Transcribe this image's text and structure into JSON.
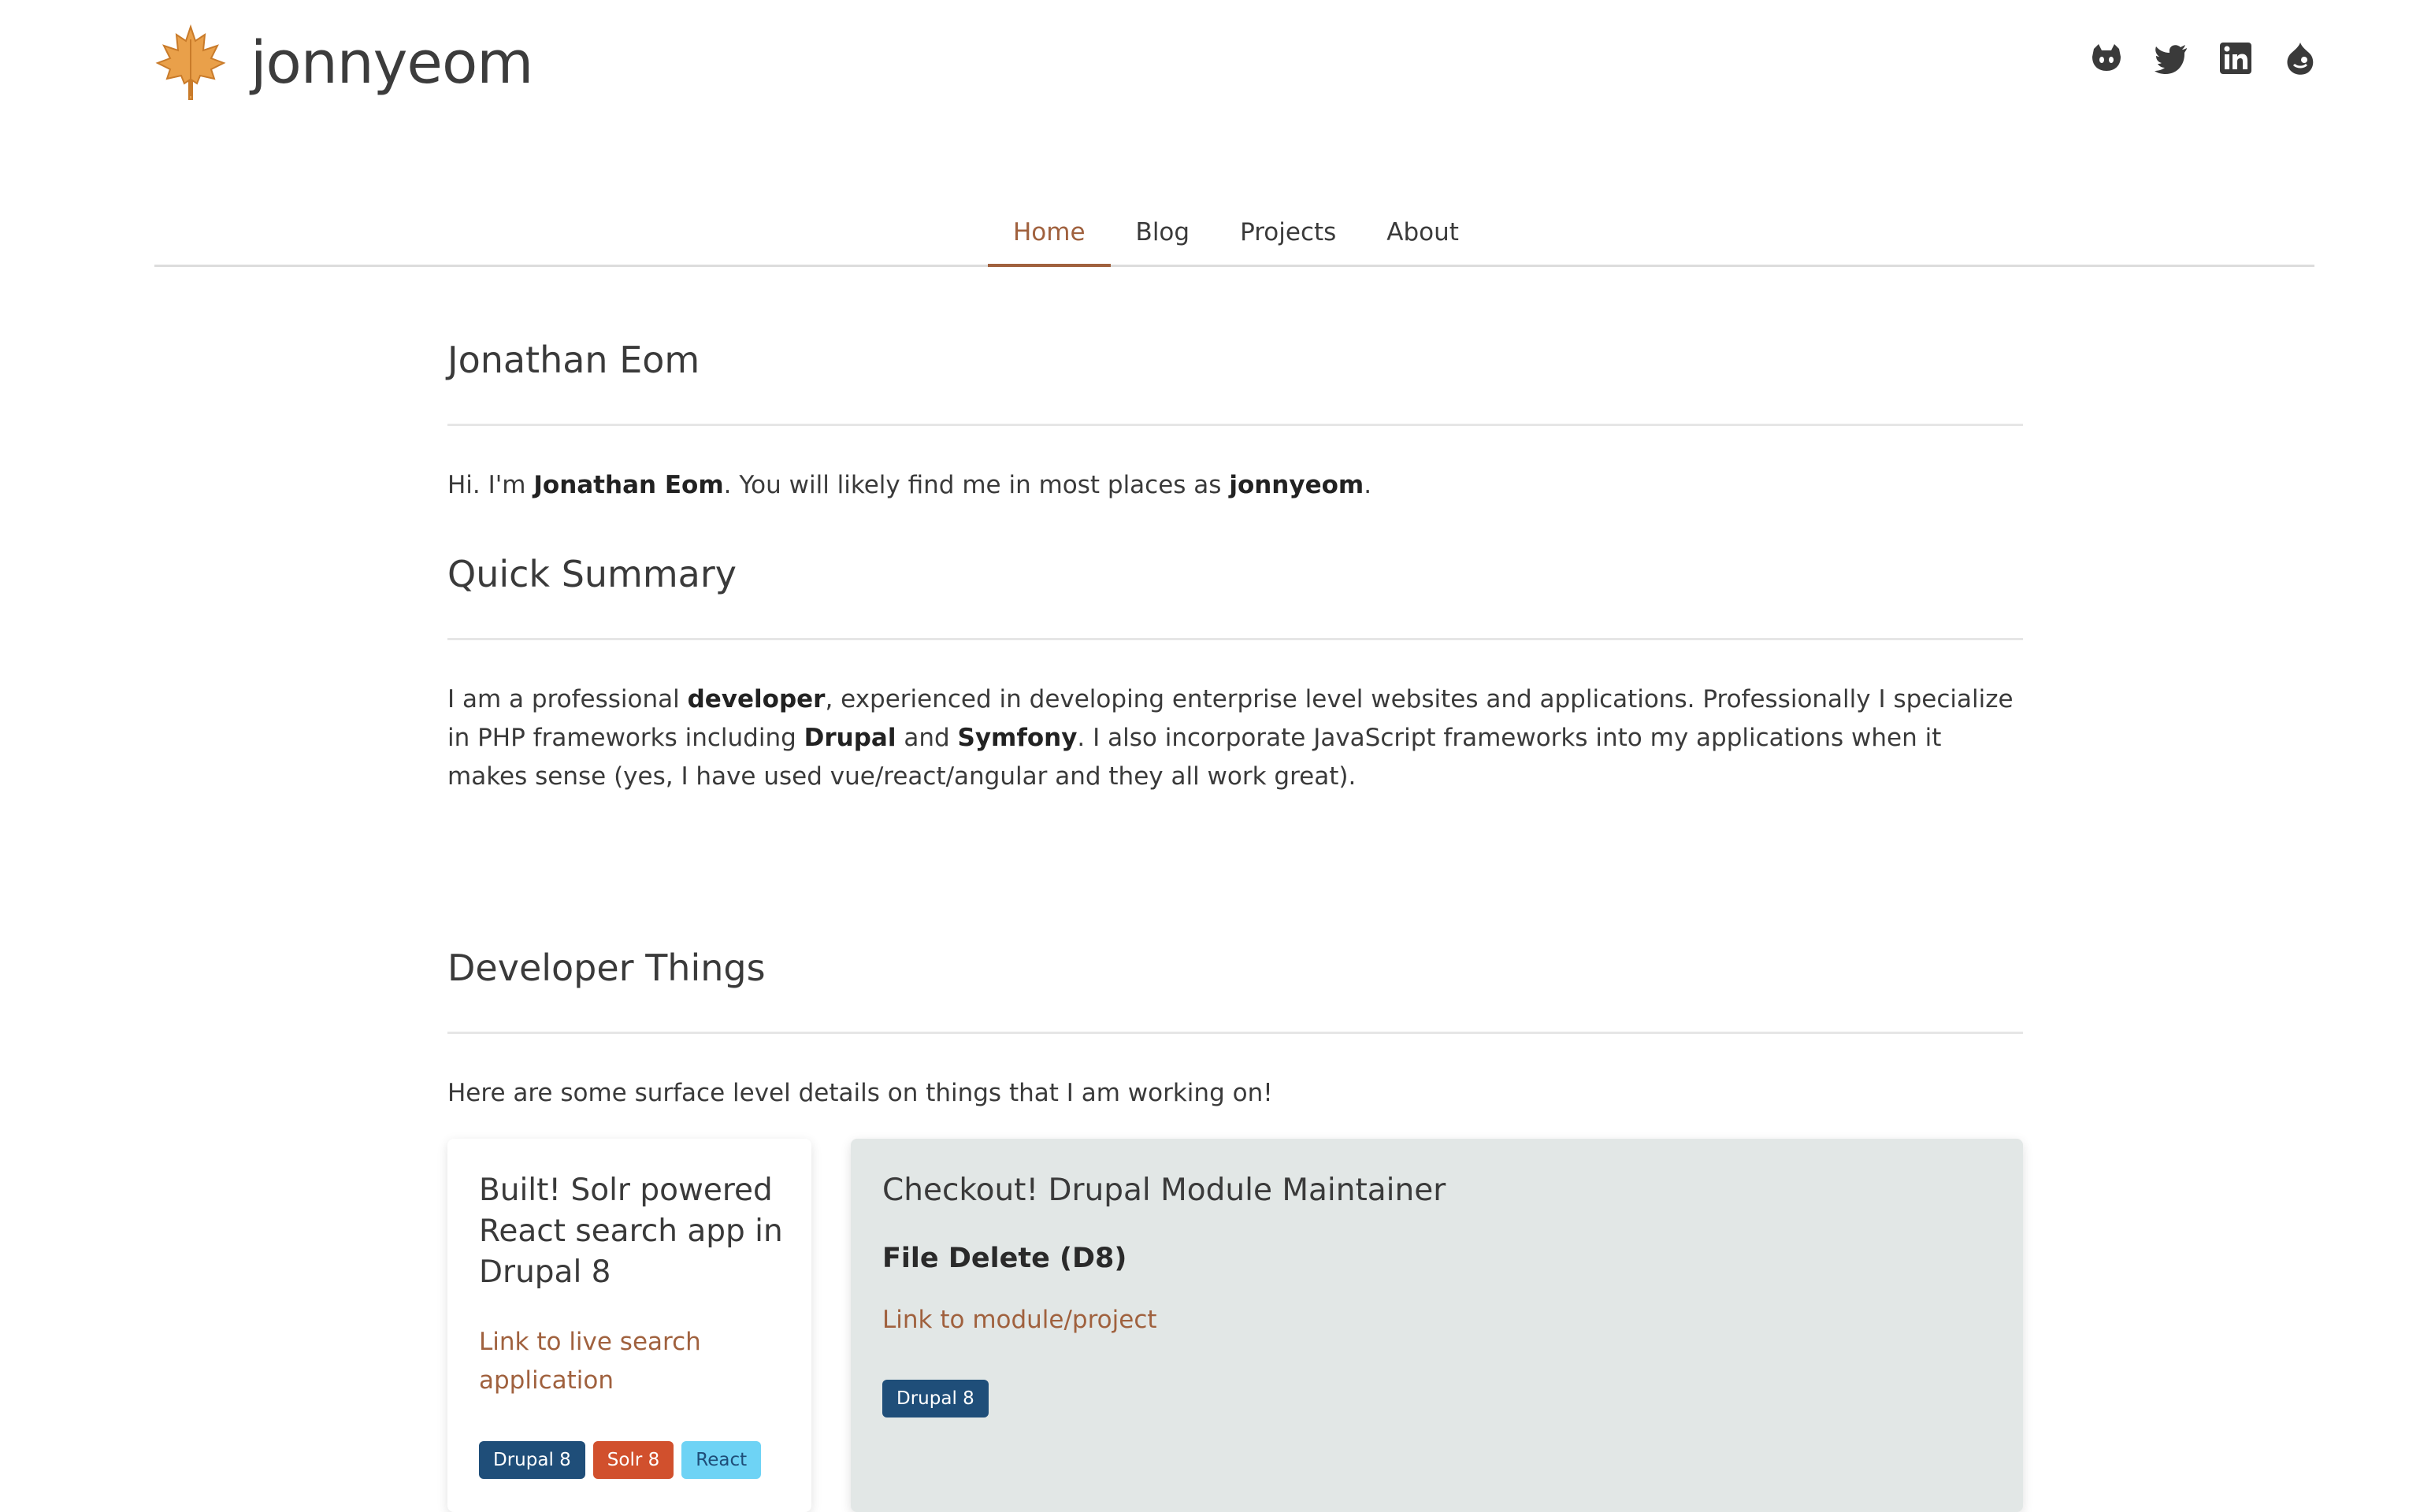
{
  "site": {
    "name": "jonnyeom",
    "logo_icon": "maple-leaf-icon",
    "social_icons": [
      "github-icon",
      "twitter-icon",
      "linkedin-icon",
      "drupal-icon"
    ]
  },
  "nav": {
    "items": [
      {
        "label": "Home",
        "active": true
      },
      {
        "label": "Blog",
        "active": false
      },
      {
        "label": "Projects",
        "active": false
      },
      {
        "label": "About",
        "active": false
      }
    ]
  },
  "intro": {
    "title": "Jonathan Eom",
    "text_1": "Hi. I'm ",
    "name_bold": "Jonathan Eom",
    "text_2": ". You will likely find me in most places as ",
    "handle_bold": "jonnyeom",
    "text_3": "."
  },
  "summary": {
    "title": "Quick Summary",
    "t1": "I am a professional ",
    "b1": "developer",
    "t2": ", experienced in developing enterprise level websites and applications. Professionally I specialize in PHP frameworks including ",
    "b2": "Drupal",
    "t3": " and ",
    "b3": "Symfony",
    "t4": ". I also incorporate JavaScript frameworks into my applications when it makes sense (yes, I have used vue/react/angular and they all work great)."
  },
  "developer": {
    "title": "Developer Things",
    "text": "Here are some surface level details on things that I am working on!"
  },
  "cards": {
    "card1": {
      "title": "Built! Solr powered React search app in Drupal 8",
      "link": "Link to live search application",
      "tags": [
        "Drupal 8",
        "Solr 8",
        "React"
      ]
    },
    "card2": {
      "title": "Checkout! Drupal Module Maintainer",
      "subtitle": "File Delete (D8)",
      "link": "Link to module/project",
      "tags": [
        "Drupal 8"
      ]
    }
  },
  "colors": {
    "accent": "#a0613e",
    "tag_drupal": "#1f4e79",
    "tag_solr": "#d1502d",
    "tag_react": "#6ed3f5",
    "card2_bg": "#e2e7e6"
  }
}
